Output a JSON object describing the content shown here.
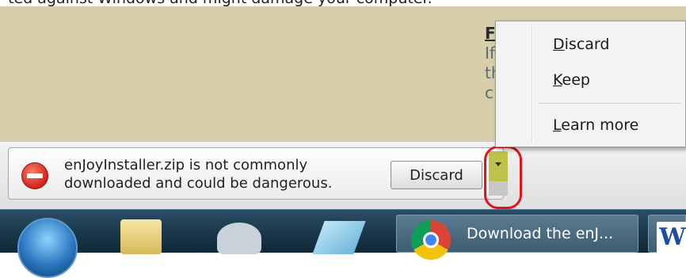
{
  "page": {
    "top_caption": "ted against Windows and might damage your computer.",
    "side_text": {
      "heading": "F",
      "lines": [
        "If",
        "th",
        "c"
      ]
    }
  },
  "download_shelf": {
    "warning_lines": [
      "enJoyInstaller.zip is not commonly",
      "downloaded and could be dangerous."
    ],
    "discard_label": "Discard",
    "dropdown_icon": "triangle-down"
  },
  "context_menu": {
    "items": [
      {
        "access_key": "D",
        "rest": "iscard"
      },
      {
        "access_key": "K",
        "rest": "eep"
      },
      {
        "access_key": "L",
        "rest": "earn more"
      }
    ]
  },
  "taskbar": {
    "chrome_label": "Download the enJ...",
    "word_letter": "W"
  },
  "colors": {
    "page_background": "#d8ceaa",
    "highlight": "#f7f51c",
    "annotation_red": "#e3131b",
    "taskbar": "#183547"
  }
}
